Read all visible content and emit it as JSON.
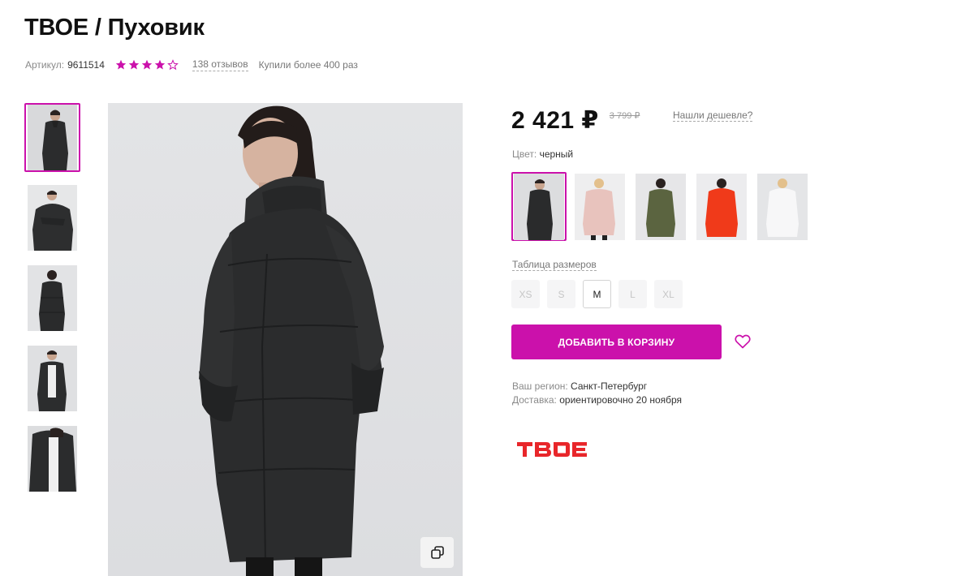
{
  "product": {
    "title": "ТВОЕ / Пуховик",
    "sku_label": "Артикул:",
    "sku_value": "9611514",
    "rating": 4,
    "rating_max": 5,
    "reviews_label": "138 отзывов",
    "bought_label": "Купили более 400 раз"
  },
  "pricing": {
    "price": "2 421 ₽",
    "old_price": "3 799 ₽",
    "cheaper_label": "Нашли дешевле?"
  },
  "color": {
    "label": "Цвет:",
    "value": "черный",
    "options": [
      {
        "name": "black",
        "hex": "#2a2b2c",
        "selected": true
      },
      {
        "name": "pink",
        "hex": "#e9c4c0",
        "selected": false
      },
      {
        "name": "olive",
        "hex": "#5d6640",
        "selected": false
      },
      {
        "name": "orange-red",
        "hex": "#f03a1a",
        "selected": false
      },
      {
        "name": "white",
        "hex": "#f4f4f6",
        "selected": false
      }
    ]
  },
  "sizes": {
    "table_label": "Таблица размеров",
    "options": [
      {
        "label": "XS",
        "available": false
      },
      {
        "label": "S",
        "available": false
      },
      {
        "label": "M",
        "available": true
      },
      {
        "label": "L",
        "available": false
      },
      {
        "label": "XL",
        "available": false
      }
    ]
  },
  "cart": {
    "button_label": "ДОБАВИТЬ В КОРЗИНУ"
  },
  "delivery": {
    "region_label": "Ваш регион:",
    "region_value": "Санкт-Петербург",
    "delivery_label": "Доставка:",
    "delivery_value": "ориентировочно 20 ноября"
  },
  "brand": {
    "logo_text": "ТВОЕ",
    "logo_color": "#e8262a"
  },
  "theme": {
    "accent": "#cb11ab"
  }
}
